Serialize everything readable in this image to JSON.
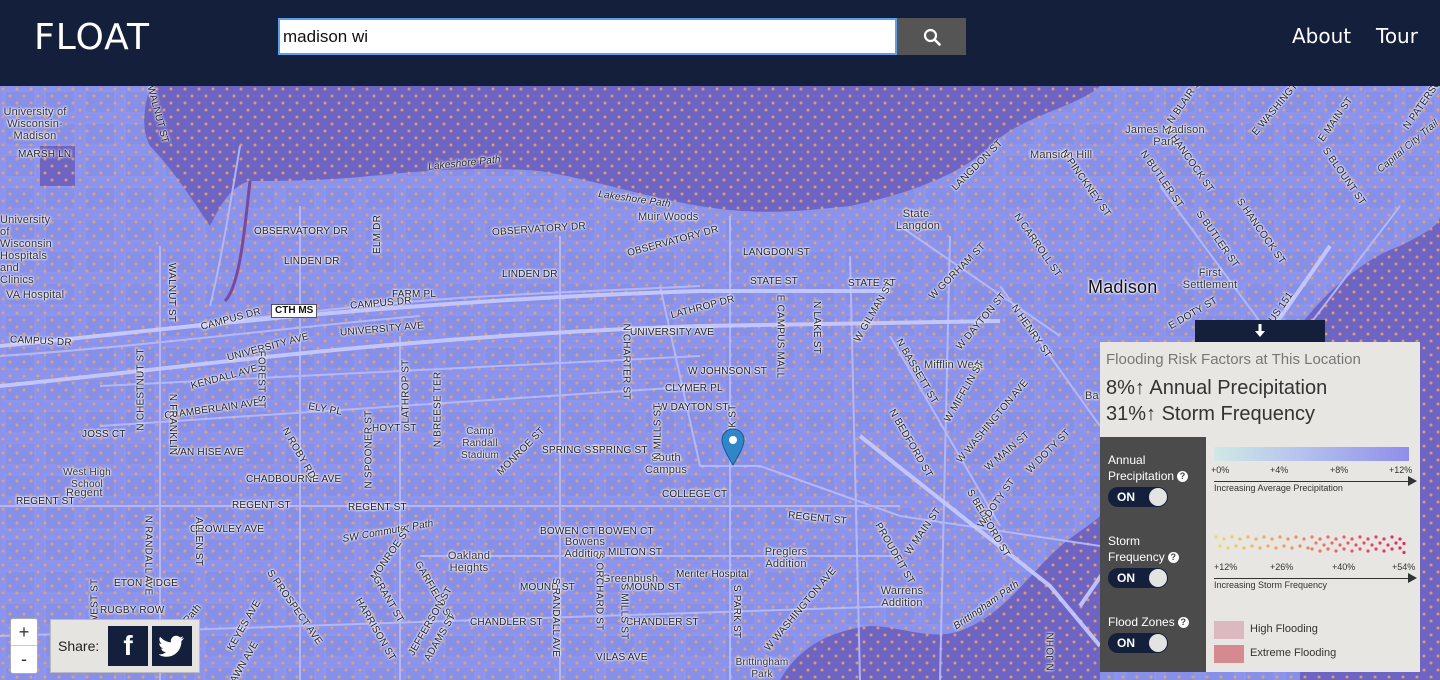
{
  "header": {
    "logo": "FLOAT",
    "search_value": "madison wi",
    "search_icon": "search-icon",
    "nav": {
      "about": "About",
      "tour": "Tour"
    }
  },
  "map": {
    "city_label": "Madison",
    "area_labels": {
      "uw": "University of Wisconsin-Madison",
      "uw_hosp": "University of Wisconsin Hospitals and Clinics",
      "va": "VA Hospital",
      "muir": "Muir Woods",
      "state_langdon": "State-Langdon",
      "mansion": "Mansion Hill",
      "james_madison": "James Madison Park",
      "first_settlement": "First Settlement",
      "mifflin": "Mifflin West",
      "camp_randall": "Camp Randall Stadium",
      "south_campus": "South Campus",
      "west_high": "West High School",
      "regent": "Regent",
      "bowens": "Bowens Addition",
      "oakland": "Oakland Heights",
      "greenbush": "Greenbush",
      "meriter": "Meriter Hospital",
      "preglers": "Preglers Addition",
      "warrens": "Warrens Addition",
      "brittingham": "Brittingham Park",
      "bay": "Ba"
    },
    "street_labels": {
      "walnut": "WALNUT ST",
      "marsh": "MARSH LN",
      "lakeshore1": "Lakeshore Path",
      "lakeshore2": "Lakeshore Path",
      "observatory1": "OBSERVATORY DR",
      "observatory2": "OBSERVATORY DR",
      "observatory3": "OBSERVATORY DR",
      "linden1": "LINDEN DR",
      "linden2": "LINDEN DR",
      "elm": "ELM DR",
      "farm": "FARM PL",
      "campus1": "CAMPUS DR",
      "campus2": "CAMPUS DR",
      "campus3": "CAMPUS DR",
      "univ1": "UNIVERSITY AVE",
      "univ2": "UNIVERSITY AVE",
      "univ3": "UNIVERSITY AVE",
      "walnut2": "WALNUT ST",
      "langdon": "LANGDON ST",
      "langdon2": "LANGDON ST",
      "state1": "STATE ST",
      "state2": "STATE ST",
      "lathrop": "LATHROP DR",
      "charter": "N CHARTER ST",
      "johnson": "W JOHNSON ST",
      "clymer": "CLYMER PL",
      "dayton": "W DAYTON ST",
      "ecampus": "E CAMPUS MALL",
      "lake": "N LAKE ST",
      "gilman": "W GILMAN ST",
      "gorham": "W GORHAM ST",
      "carroll": "N CARROLL ST",
      "henry": "N HENRY ST",
      "wdayton2": "W DAYTON ST",
      "mifflin_st": "W MIFFLIN ST",
      "bassett": "N BASSETT ST",
      "washington1": "W WASHINGTON AVE",
      "main": "W MAIN ST",
      "doty": "W DOTY ST",
      "bedford": "N BEDFORD ST",
      "pinckney": "N PINCKNEY ST",
      "butler": "N BUTLER ST",
      "hancock": "N HANCOCK ST",
      "sbutler": "S BUTLER ST",
      "shancock": "S HANCOCK ST",
      "blair": "N BLAIR ST",
      "ewash": "E WASHINGTON",
      "emain": "E MAIN ST",
      "sblount": "S BLOUNT ST",
      "spatersonn": "N PATERSON",
      "capitalcity": "Capital City Trail",
      "edoty": "E DOTY ST",
      "us151": "US 151",
      "kendall": "KENDALL AVE",
      "chamberlain": "CHAMBERLAIN AVE",
      "chestnut": "N CHESTNUT ST",
      "forest": "FOREST ST",
      "joss": "JOSS CT",
      "vanhise": "VAN HISE AVE",
      "elly": "ELY PL",
      "lathrop2": "LATHROP ST",
      "breese": "N BREESE TER",
      "hoyt": "HOYT ST",
      "spooner": "N SPOONER ST",
      "roby": "N ROBY RD",
      "monroe": "MONROE ST",
      "spring1": "SPRING ST",
      "spring2": "SPRING ST",
      "mills": "N MILLS ST",
      "npark": "N PARK ST",
      "college": "COLLEGE CT",
      "regent1": "REGENT ST",
      "regent2": "REGENT ST",
      "regent3": "REGENT ST",
      "regent4": "REGENT ST",
      "chadbourne": "CHADBOURNE AVE",
      "crowley": "CROWLEY AVE",
      "swcommuter": "SW Commuter Path",
      "bowen": "BOWEN CT BOWEN CT",
      "milton": "MILTON ST",
      "mound": "MOUND ST",
      "mound2": "MOUND ST",
      "chandler1": "CHANDLER ST",
      "chandler2": "CHANDLER ST",
      "vilas": "VILAS AVE",
      "spark": "S PARK ST",
      "sorchard": "S ORCHARD ST",
      "srandall": "S RANDALL AVE",
      "smills": "S MILLS ST",
      "proudfit": "PROUDFIT ST",
      "wwash2": "W WASHINGTON AVE",
      "swmain": "W MAIN ST",
      "sbedford": "S BEDFORD ST",
      "wdoty2": "W DOTY ST",
      "brittpath": "Brittingham Path",
      "njohn": "N JOHN",
      "eton": "ETON RIDGE",
      "rugby": "RUGBY ROW",
      "keyes": "KEYES AVE",
      "sprospect": "S PROSPECT AVE",
      "harrison": "HARRISON ST",
      "grant": "GRANT ST",
      "garfield": "GARFIELD ST",
      "jefferson": "JEFFERSON ST",
      "adams": "ADAMS ST",
      "commuterpath2": "Commuter Path",
      "hawn": "HAWN AVE",
      "allen": "ALLEN ST",
      "randall": "N RANDALL AVE",
      "west": "WEST ST",
      "sfranklin": "N FRANKLIN"
    },
    "shield_label": "CTH MS"
  },
  "controls": {
    "zoom_in": "+",
    "zoom_out": "-"
  },
  "share": {
    "label": "Share:",
    "facebook_glyph": "f"
  },
  "panel": {
    "title": "Flooding Risk Factors at This Location",
    "stat1": "8%↑ Annual Precipitation",
    "stat2": "31%↑ Storm Frequency",
    "layers": [
      {
        "label": "Annual Precipitation",
        "toggle": "ON"
      },
      {
        "label": "Storm Frequency",
        "toggle": "ON"
      },
      {
        "label": "Flood Zones",
        "toggle": "ON"
      }
    ],
    "help_glyph": "?",
    "precip_ticks": [
      "+0%",
      "+4%",
      "+8%",
      "+12%"
    ],
    "precip_caption": "Increasing Average Precipitation",
    "storm_ticks": [
      "+12%",
      "+26%",
      "+40%",
      "+54%"
    ],
    "storm_caption": "Increasing Storm Frequency",
    "flood_legend": [
      {
        "label": "High Flooding",
        "color": "#dcb8bf"
      },
      {
        "label": "Extreme Flooding",
        "color": "#d48a8f"
      }
    ]
  },
  "colors": {
    "header_bg": "#141f3b",
    "precip_overlay": "#8b93ec",
    "flood_zone": "#6e64c4",
    "storm_dots": "#f0a35a"
  }
}
